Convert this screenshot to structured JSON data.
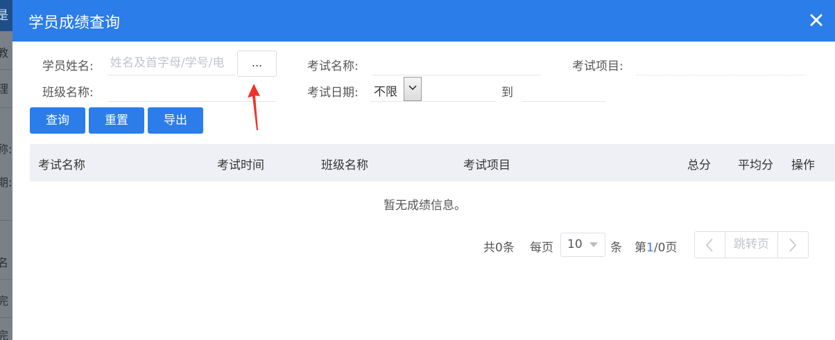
{
  "background": {
    "top_char": "是",
    "strip_chars": [
      "教",
      "理",
      "称:",
      "期:",
      "名",
      "完",
      "完"
    ]
  },
  "dialog": {
    "title": "学员成绩查询",
    "close_icon": "close-icon"
  },
  "form": {
    "student_name_label": "学员姓名:",
    "student_name_placeholder": "姓名及首字母/学号/电",
    "picker_button": "...",
    "exam_name_label": "考试名称:",
    "exam_name_value": "",
    "exam_item_label": "考试项目:",
    "exam_item_value": "",
    "class_name_label": "班级名称:",
    "class_name_value": "",
    "exam_date_label": "考试日期:",
    "exam_date_option": "不限",
    "date_to_label": "到",
    "date_to_value": ""
  },
  "buttons": {
    "query": "查询",
    "reset": "重置",
    "export": "导出"
  },
  "table": {
    "columns": [
      "考试名称",
      "考试时间",
      "班级名称",
      "考试项目",
      "总分",
      "平均分",
      "操作"
    ],
    "empty_message": "暂无成绩信息。"
  },
  "pagination": {
    "total_prefix": "共",
    "total_count": "0",
    "total_suffix": "条",
    "per_page_label": "每页",
    "page_size": "10",
    "per_page_unit": "条",
    "page_prefix": "第",
    "current_page": "1",
    "page_sep": "/",
    "total_pages": "0",
    "page_suffix": "页",
    "jump_label": "跳转页"
  },
  "colors": {
    "header": "#2b7de9",
    "primary_button": "#2b7de9",
    "table_header_bg": "#eef0f5",
    "annotation_arrow": "#f0332a"
  }
}
